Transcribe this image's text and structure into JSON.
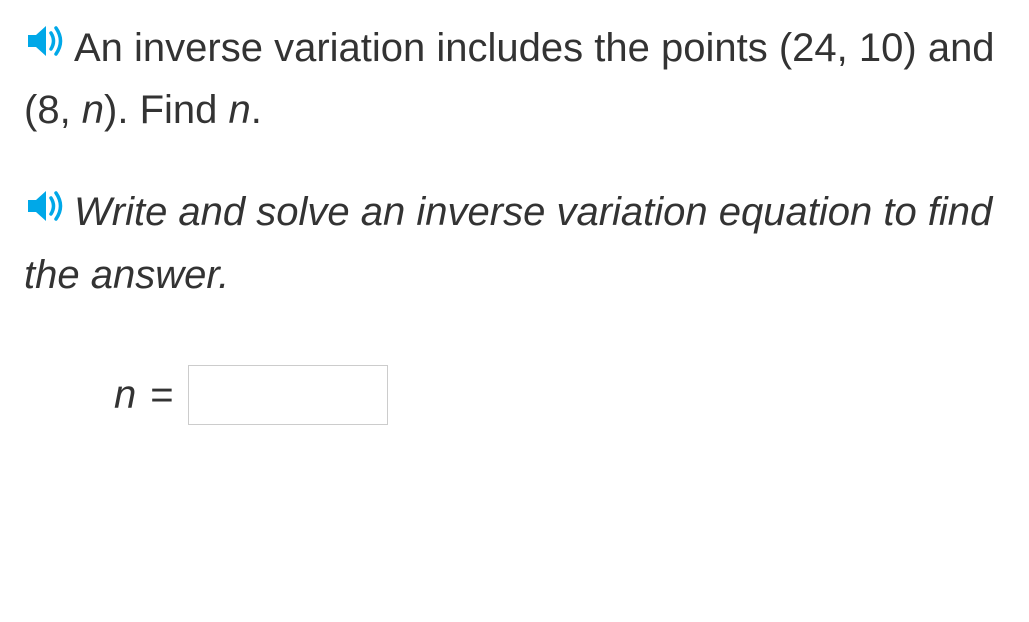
{
  "problem": {
    "text_part1": "An ",
    "text_part2": "inverse variation includes the points (24, 10) and (8, ",
    "variable1": "n",
    "text_part3": "). Find ",
    "variable2": "n",
    "text_part4": "."
  },
  "instruction": {
    "text": "Write and solve an inverse variation equation to find the answer."
  },
  "answer": {
    "variable": "n",
    "equals": " = ",
    "value": ""
  },
  "icons": {
    "speaker": "speaker-icon"
  }
}
